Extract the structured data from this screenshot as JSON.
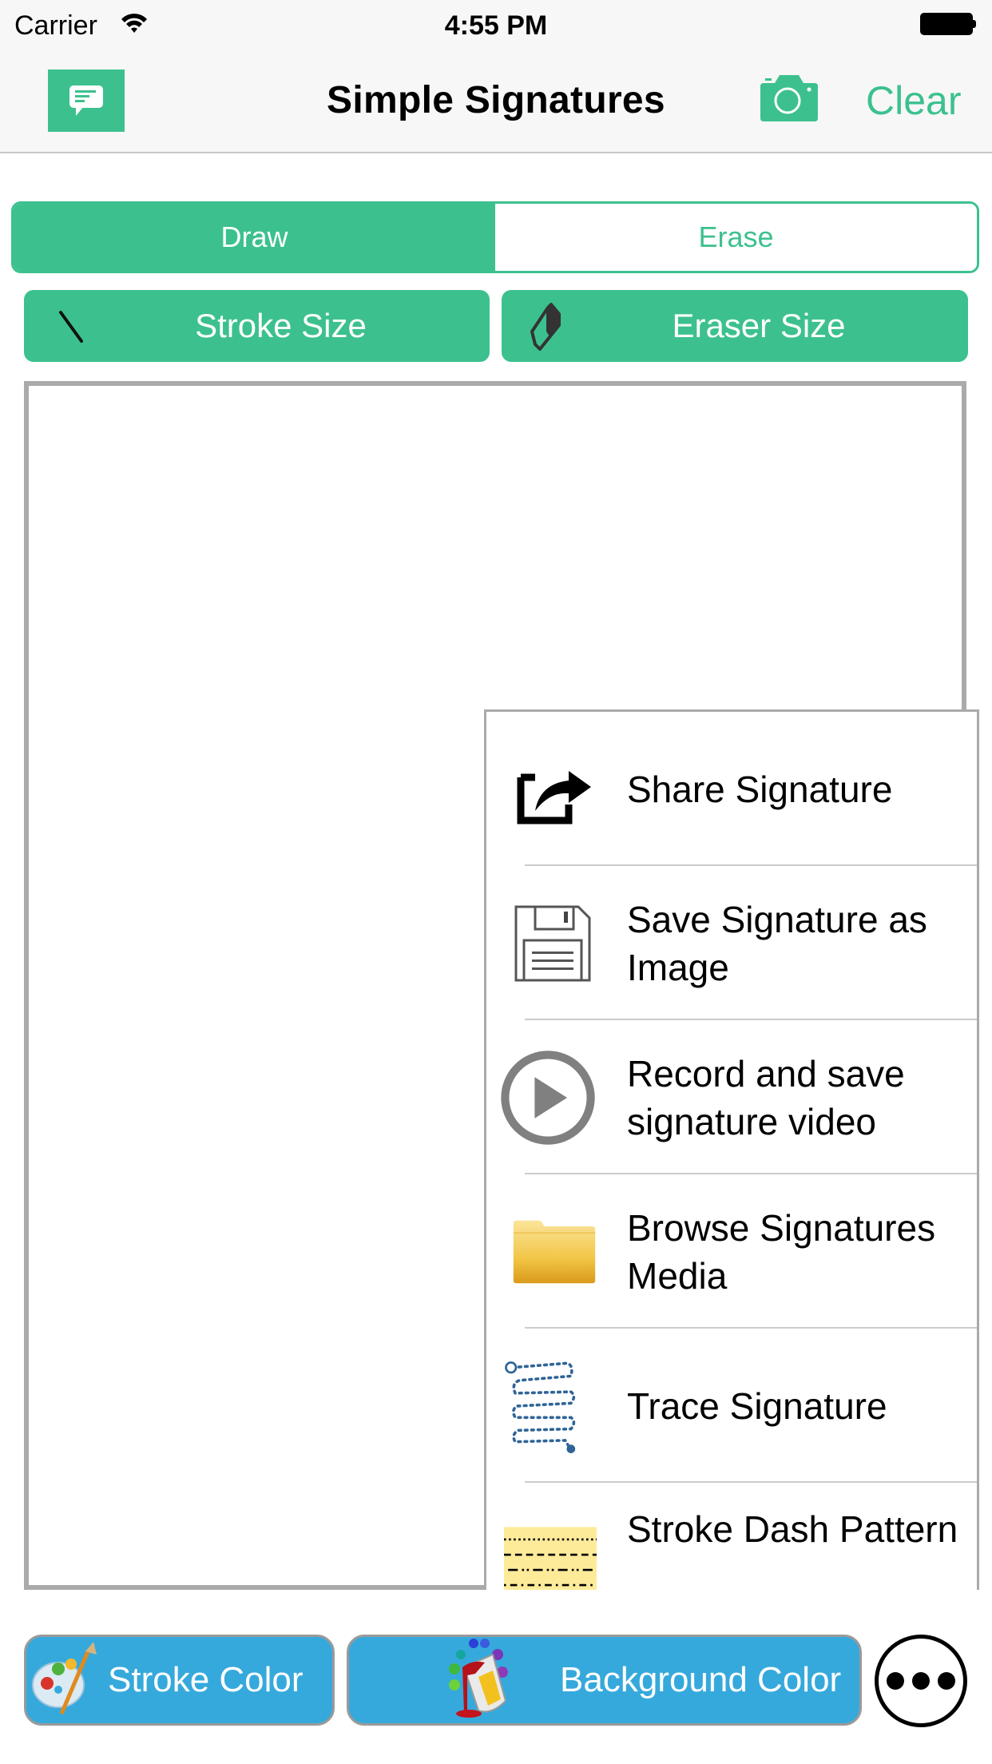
{
  "status_bar": {
    "carrier": "Carrier",
    "time": "4:55 PM",
    "wifi_icon": "wifi-icon",
    "battery_icon": "battery-full-icon"
  },
  "nav_bar": {
    "title": "Simple Signatures",
    "feedback_icon": "chat-bubble-icon",
    "camera_icon": "camera-icon",
    "clear_label": "Clear"
  },
  "mode_control": {
    "segments": [
      {
        "label": "Draw",
        "selected": true
      },
      {
        "label": "Erase",
        "selected": false
      }
    ]
  },
  "size_buttons": {
    "stroke": {
      "label": "Stroke Size",
      "icon": "brush-stroke-icon"
    },
    "eraser": {
      "label": "Eraser Size",
      "icon": "eraser-icon"
    }
  },
  "menu": {
    "items": [
      {
        "label": "Share Signature",
        "icon": "share-icon"
      },
      {
        "label": "Save Signature as Image",
        "icon": "floppy-disk-icon"
      },
      {
        "label": "Record and save signature video",
        "icon": "play-circle-icon"
      },
      {
        "label": "Browse Signatures Media",
        "icon": "folder-icon"
      },
      {
        "label": "Trace Signature",
        "icon": "dotted-path-icon"
      },
      {
        "label": "Stroke Dash Pattern",
        "icon": "dash-pattern-icon"
      }
    ]
  },
  "bottom_toolbar": {
    "stroke_color_label": "Stroke Color",
    "stroke_color_icon": "palette-icon",
    "background_color_label": "Background Color",
    "background_color_icon": "paint-bucket-icon",
    "more_icon": "more-dots-icon"
  },
  "colors": {
    "accent_green": "#3cc18e",
    "toolbar_blue": "#36a9dc",
    "border_gray": "#aaaaaa"
  }
}
